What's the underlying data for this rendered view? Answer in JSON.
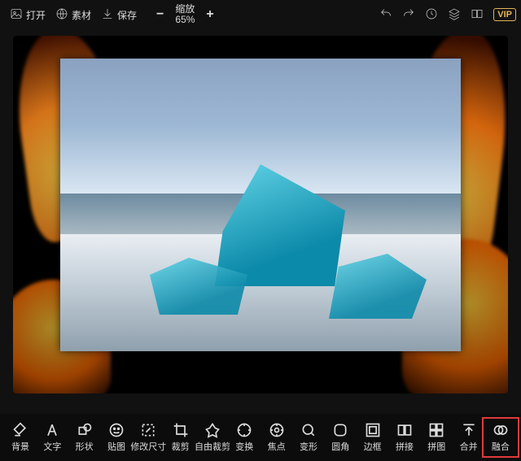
{
  "topbar": {
    "open_label": "打开",
    "assets_label": "素材",
    "save_label": "保存",
    "zoom_title": "缩放",
    "zoom_value": "65%",
    "zoom_minus": "−",
    "zoom_plus": "+",
    "vip_label": "VIP"
  },
  "tools": {
    "background": "背景",
    "text": "文字",
    "shape": "形状",
    "sticker": "贴图",
    "resize": "修改尺寸",
    "crop": "裁剪",
    "freecrop": "自由裁剪",
    "transform": "变换",
    "focus": "焦点",
    "distort": "变形",
    "round": "圆角",
    "border": "边框",
    "stitch": "拼接",
    "split": "拼图",
    "merge": "合并",
    "blend": "融合"
  }
}
